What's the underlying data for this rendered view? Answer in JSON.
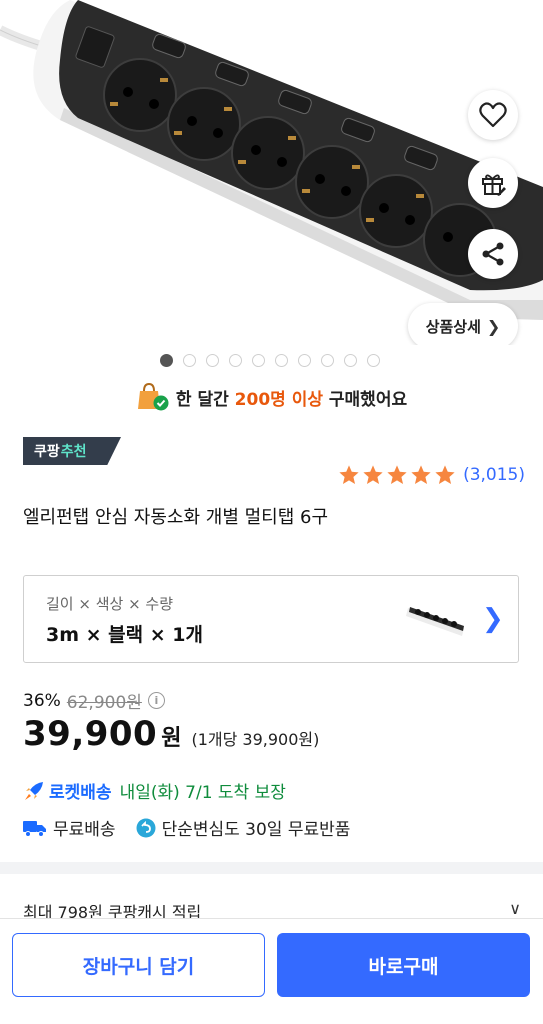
{
  "hero": {
    "detail_button_label": "상품상세",
    "image_count": 10,
    "active_image_index": 0
  },
  "purchase_banner": {
    "prefix": "한 달간 ",
    "highlight": "200명 이상",
    "suffix": " 구매했어요"
  },
  "badge": {
    "part1": "쿠팡",
    "part2": "추천",
    "bg_color": "#333d4b",
    "accent_color": "#5fe3c9"
  },
  "rating": {
    "stars": 5,
    "count": "(3,015)",
    "star_color": "#f6863f"
  },
  "product": {
    "title": "엘리펀탭 안심 자동소화 개별 멀티탭 6구"
  },
  "option": {
    "label": "길이 × 색상 × 수량",
    "value": "3m × 블랙 × 1개"
  },
  "price": {
    "discount": "36%",
    "original": "62,900원",
    "current": "39,900",
    "currency": "원",
    "unit_price": "(1개당 39,900원)"
  },
  "delivery": {
    "rocket_label": "로켓배송",
    "arrival": "내일(화) 7/1 도착 보장",
    "free_shipping": "무료배송",
    "free_return": "단순변심도 30일 무료반품"
  },
  "cash": {
    "text": "최대 798원 쿠팡캐시 적립"
  },
  "actions": {
    "cart_label": "장바구니 담기",
    "buy_label": "바로구매"
  },
  "colors": {
    "accent": "#346aff",
    "rocket": "#1b6bff",
    "arrival": "#0f8c3c",
    "highlight": "#e8580c"
  }
}
